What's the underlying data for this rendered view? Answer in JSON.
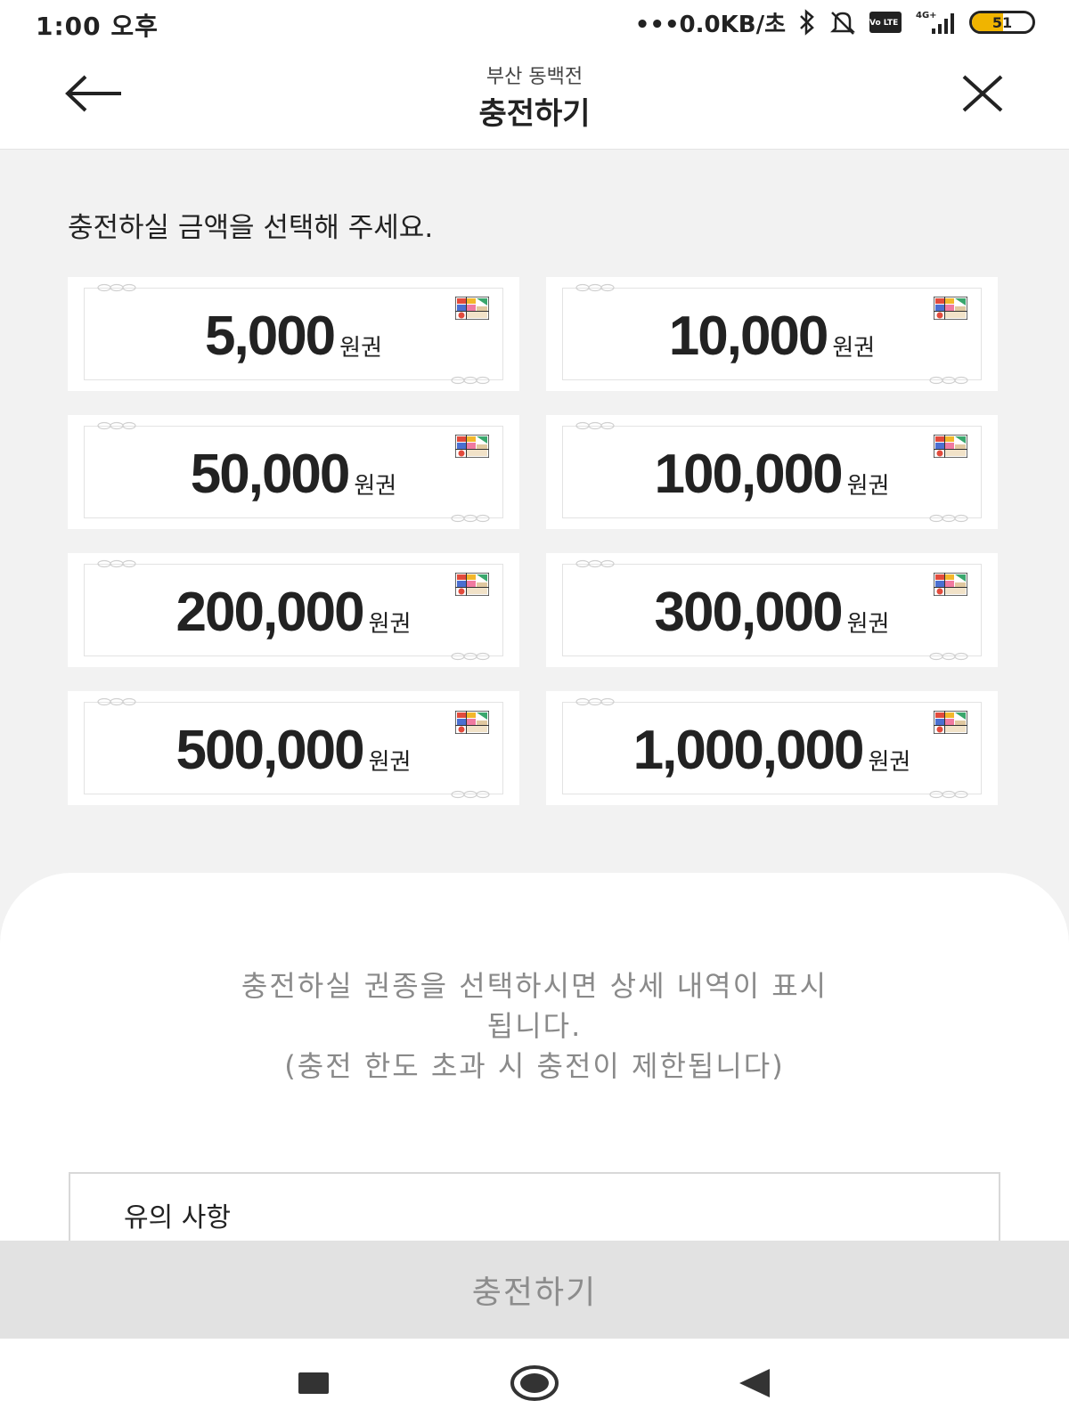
{
  "status_bar": {
    "time": "1:00 오후",
    "network_speed": "•••0.0KB/초",
    "volte_label": "Vo LTE",
    "signal_label": "4G+",
    "battery_level": "51"
  },
  "header": {
    "subtitle": "부산 동백전",
    "title": "충전하기",
    "back_icon": "arrow-left-icon",
    "close_icon": "close-icon"
  },
  "prompt": "충전하실 금액을 선택해 주세요.",
  "vouchers": [
    {
      "amount": "5,000",
      "unit": "원권"
    },
    {
      "amount": "10,000",
      "unit": "원권"
    },
    {
      "amount": "50,000",
      "unit": "원권"
    },
    {
      "amount": "100,000",
      "unit": "원권"
    },
    {
      "amount": "200,000",
      "unit": "원권"
    },
    {
      "amount": "300,000",
      "unit": "원권"
    },
    {
      "amount": "500,000",
      "unit": "원권"
    },
    {
      "amount": "1,000,000",
      "unit": "원권"
    }
  ],
  "info": {
    "line1": "충전하실 권종을 선택하시면 상세 내역이 표시",
    "line2": "됩니다.",
    "line3": "(충전 한도 초과 시 충전이 제한됩니다)"
  },
  "notice": {
    "title": "유의 사항"
  },
  "charge_button": {
    "label": "충전하기"
  },
  "colors": {
    "background": "#f2f2f2",
    "card": "#ffffff",
    "button_disabled": "#e2e2e2",
    "battery": "#f0b400"
  }
}
